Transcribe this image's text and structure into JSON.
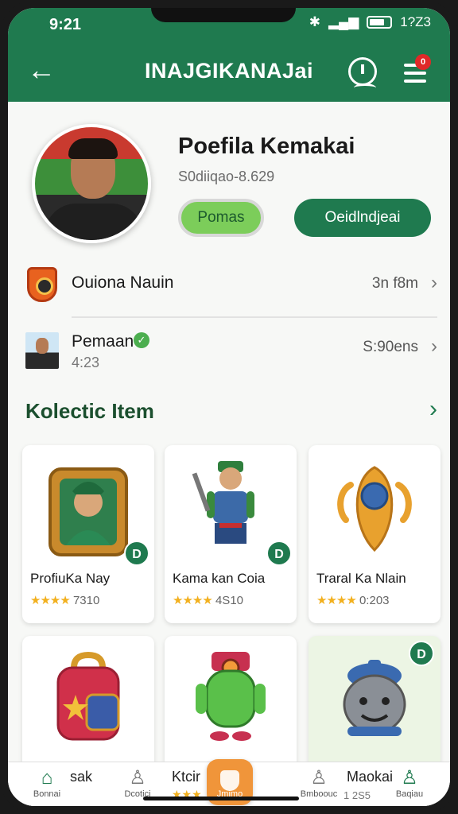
{
  "status_bar": {
    "time": "9:21",
    "signal_text": "1?Z3",
    "bluetooth_icon": "bluetooth-icon",
    "signal_icon": "signal-icon",
    "battery_icon": "battery-icon"
  },
  "app_bar": {
    "back_icon": "←",
    "title": "INAJGIKANAJai",
    "info_icon": "info-icon",
    "menu_icon": "menu-icon",
    "menu_badge": "0"
  },
  "profile": {
    "name": "Poefila Kemakai",
    "subtitle": "S0diiqao-8.629",
    "primary_button": "Pomas",
    "secondary_button": "Oeidlndjeai"
  },
  "rows": [
    {
      "label": "Ouiona Nauin",
      "sub": "",
      "meta": "3n f8m",
      "icon": "club-badge-icon"
    },
    {
      "label": "Pemaan",
      "sub": "4:23",
      "meta": "S:90ens",
      "icon": "user-avatar-icon"
    }
  ],
  "section": {
    "title": "Kolectic Item",
    "chevron": "›"
  },
  "cards": [
    {
      "title": "ProfiuKa Nay",
      "stars": "★★★★",
      "rating": "7310",
      "badge": "D"
    },
    {
      "title": "Kama kan Coia",
      "stars": "★★★★",
      "rating": "4S10",
      "badge": "D"
    },
    {
      "title": "Traral Ka Nlain",
      "stars": "★★★★",
      "rating": "0:203",
      "badge": ""
    },
    {
      "title": "",
      "stars": "",
      "rating": "",
      "badge": ""
    },
    {
      "title": "",
      "stars": "",
      "rating": "",
      "badge": ""
    },
    {
      "title": "",
      "stars": "",
      "rating": "",
      "badge": "D"
    }
  ],
  "tabbar": {
    "tabs": [
      {
        "label": "Bonnai",
        "icon": "⌂"
      },
      {
        "label": "Dcotici",
        "icon": "♙"
      },
      {
        "label": "Jmimo",
        "icon": ""
      },
      {
        "label": "Bmboouc",
        "icon": "♙"
      },
      {
        "label": "Baqiau",
        "icon": "♙"
      }
    ],
    "extra_left": "sak",
    "extra_center": "Ktcir",
    "extra_center_stars": "★★★",
    "extra_right": "Maokai",
    "extra_right_num": "1 2S5"
  },
  "colors": {
    "brand_green": "#1f7a4f",
    "accent_orange": "#f0953a",
    "star": "#f2b01e"
  }
}
